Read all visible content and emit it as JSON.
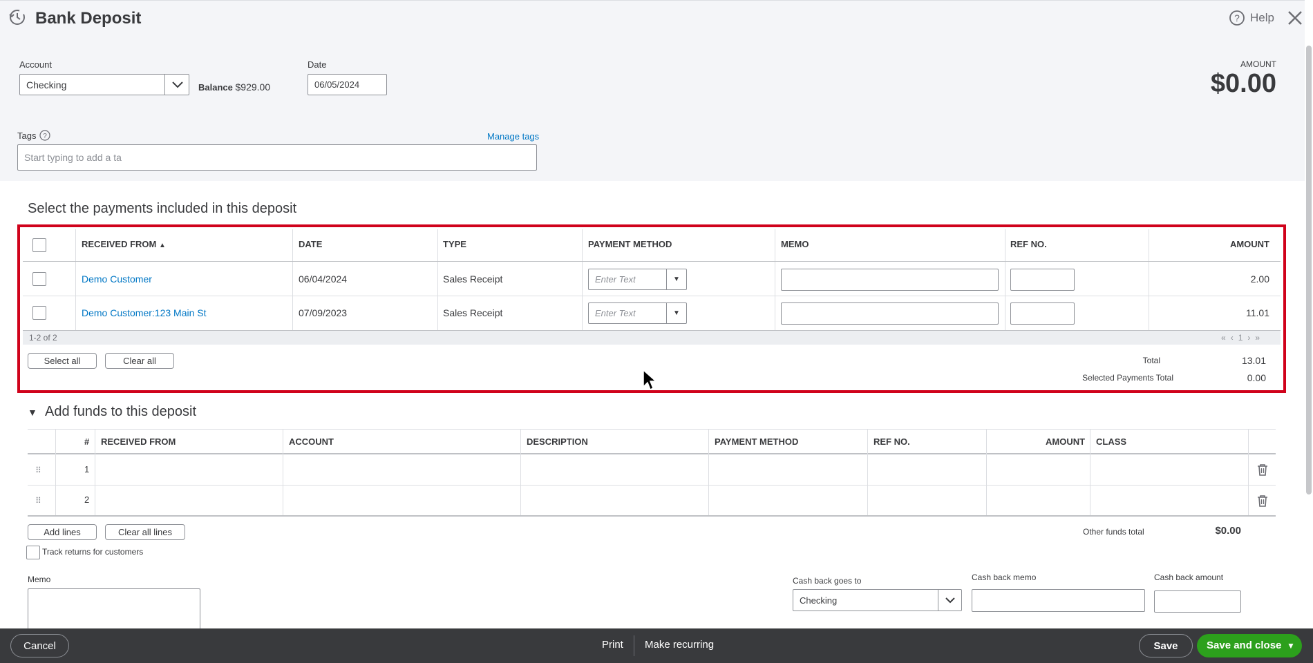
{
  "header": {
    "title": "Bank Deposit",
    "help_label": "Help"
  },
  "account": {
    "label": "Account",
    "value": "Checking",
    "balance_label": "Balance",
    "balance_value": "$929.00"
  },
  "date": {
    "label": "Date",
    "value": "06/05/2024"
  },
  "amount": {
    "label": "AMOUNT",
    "value": "$0.00"
  },
  "tags": {
    "label": "Tags",
    "manage_label": "Manage tags",
    "placeholder": "Start typing to add a ta"
  },
  "payments": {
    "heading": "Select the payments included in this deposit",
    "columns": {
      "received_from": "RECEIVED FROM",
      "date": "DATE",
      "type": "TYPE",
      "payment_method": "PAYMENT METHOD",
      "memo": "MEMO",
      "ref_no": "REF NO.",
      "amount": "AMOUNT"
    },
    "rows": [
      {
        "received_from": "Demo Customer",
        "date": "06/04/2024",
        "type": "Sales Receipt",
        "method_placeholder": "Enter Text",
        "amount": "2.00"
      },
      {
        "received_from": "Demo Customer:123 Main St",
        "date": "07/09/2023",
        "type": "Sales Receipt",
        "method_placeholder": "Enter Text",
        "amount": "11.01"
      }
    ],
    "range": "1-2 of 2",
    "page": "1",
    "select_all": "Select all",
    "clear_all": "Clear all",
    "total_label": "Total",
    "total_value": "13.01",
    "selected_label": "Selected Payments Total",
    "selected_value": "0.00"
  },
  "funds": {
    "heading": "Add funds to this deposit",
    "columns": {
      "num": "#",
      "received_from": "RECEIVED FROM",
      "account": "ACCOUNT",
      "description": "DESCRIPTION",
      "payment_method": "PAYMENT METHOD",
      "ref_no": "REF NO.",
      "amount": "AMOUNT",
      "class": "CLASS"
    },
    "rows": [
      {
        "num": "1"
      },
      {
        "num": "2"
      }
    ],
    "add_lines": "Add lines",
    "clear_all_lines": "Clear all lines",
    "other_total_label": "Other funds total",
    "other_total_value": "$0.00",
    "track_returns": "Track returns for customers"
  },
  "memo": {
    "label": "Memo"
  },
  "cashback": {
    "goes_to_label": "Cash back goes to",
    "goes_to_value": "Checking",
    "memo_label": "Cash back memo",
    "amount_label": "Cash back amount"
  },
  "footer": {
    "cancel": "Cancel",
    "print": "Print",
    "make_recurring": "Make recurring",
    "save": "Save",
    "save_close": "Save and close"
  },
  "colors": {
    "accent": "#0077c5",
    "highlight": "#d0021b",
    "primary": "#2ca01c",
    "footer_bg": "#393a3d"
  }
}
